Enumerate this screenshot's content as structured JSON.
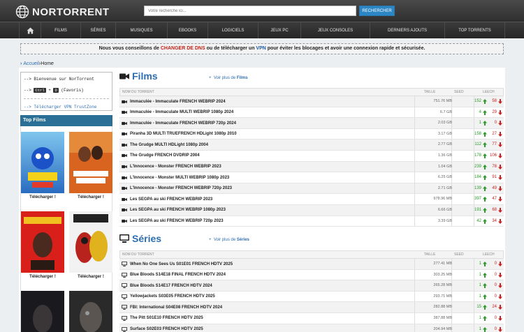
{
  "header": {
    "site_name": "NORTORRENT",
    "search_placeholder": "Votre recherche ici...",
    "search_button": "RECHERCHER"
  },
  "nav": {
    "items": [
      "FILMS",
      "SÉRIES",
      "MUSIQUES",
      "EBOOKS",
      "LOGICIELS",
      "JEUX PC",
      "JEUX CONSOLES",
      "DERNIERS AJOUTS",
      "TOP TORRENTS"
    ]
  },
  "banner": {
    "part1": "Nous vous conseillons de ",
    "link1": "CHANGER DE DNS",
    "part2": " ou de télécharger un ",
    "link2": "VPN",
    "part3": " pour éviter les blocages et avoir une connexion rapide et sécurisée."
  },
  "breadcrumb": {
    "home": "Accueil",
    "sep": " › ",
    "current": "Home"
  },
  "sidebar": {
    "welcome": "--> Bienvenue sur NorTorrent",
    "shortcut_prefix": "-->",
    "key1": "Ctrl",
    "plus": "+",
    "key2": "D",
    "shortcut_suffix": "(Favoris)",
    "vpn_link": "--> Télécharger VPN TrustZone",
    "top_films_title": "Top Films",
    "download_label": "Télécharger !"
  },
  "films": {
    "title": "Films",
    "more_prefix": "Voir plus de ",
    "more_bold": "Films",
    "col_name": "NOM DU TORRENT",
    "col_size": "TAILLE",
    "col_seed": "SEED",
    "col_leech": "LEECH",
    "rows": [
      {
        "name": "Immaculée - Immaculate FRENCH WEBRIP 2024",
        "size": "751.76 MB",
        "seed": "152",
        "leech": "58"
      },
      {
        "name": "Immaculée - Immaculate MULTI WEBRIP 1080p 2024",
        "size": "6.7 GB",
        "seed": "4",
        "leech": "29"
      },
      {
        "name": "Immaculée - Immaculate FRENCH WEBRIP 720p 2024",
        "size": "2.03 GB",
        "seed": "1",
        "leech": "0"
      },
      {
        "name": "Piranha 3D MULTI TRUEFRENCH HDLight 1080p 2010",
        "size": "3.17 GB",
        "seed": "158",
        "leech": "27"
      },
      {
        "name": "The Grudge MULTI HDLight 1080p 2004",
        "size": "2.77 GB",
        "seed": "112",
        "leech": "77"
      },
      {
        "name": "The Grudge FRENCH DVDRIP 2004",
        "size": "1.36 GB",
        "seed": "178",
        "leech": "106"
      },
      {
        "name": "L'Innocence - Monster FRENCH WEBRIP 2023",
        "size": "1.04 GB",
        "seed": "239",
        "leech": "78"
      },
      {
        "name": "L'Innocence - Monster MULTI WEBRIP 1080p 2023",
        "size": "6.25 GB",
        "seed": "184",
        "leech": "91"
      },
      {
        "name": "L'Innocence - Monster FRENCH WEBRIP 720p 2023",
        "size": "2.71 GB",
        "seed": "139",
        "leech": "49"
      },
      {
        "name": "Les SEGPA au ski FRENCH WEBRIP 2023",
        "size": "978.96 MB",
        "seed": "397",
        "leech": "47"
      },
      {
        "name": "Les SEGPA au ski FRENCH WEBRIP 1080p 2023",
        "size": "6.66 GB",
        "seed": "191",
        "leech": "68"
      },
      {
        "name": "Les SEGPA au ski FRENCH WEBRIP 720p 2023",
        "size": "3.39 GB",
        "seed": "42",
        "leech": "34"
      }
    ]
  },
  "series": {
    "title": "Séries",
    "more_prefix": "Voir plus de ",
    "more_bold": "Séries",
    "col_name": "NOM DU TORRENT",
    "col_size": "TAILLE",
    "col_seed": "SEED",
    "col_leech": "LEECH",
    "rows": [
      {
        "name": "When No One Sees Us S01E01 FRENCH HDTV 2025",
        "size": "277.41 MB",
        "seed": "1",
        "leech": "0"
      },
      {
        "name": "Blue Bloods S14E18 FINAL FRENCH HDTV 2024",
        "size": "303.25 MB",
        "seed": "1",
        "leech": "0"
      },
      {
        "name": "Blue Bloods S14E17 FRENCH HDTV 2024",
        "size": "265.28 MB",
        "seed": "1",
        "leech": "0"
      },
      {
        "name": "Yellowjackets S03E05 FRENCH HDTV 2025",
        "size": "293.71 MB",
        "seed": "1",
        "leech": "0"
      },
      {
        "name": "FBI: International S04E08 FRENCH HDTV 2024",
        "size": "282.88 MB",
        "seed": "15",
        "leech": "24"
      },
      {
        "name": "The Pitt S01E10 FRENCH HDTV 2025",
        "size": "387.88 MB",
        "seed": "1",
        "leech": "0"
      },
      {
        "name": "Surface S02E03 FRENCH HDTV 2025",
        "size": "204.94 MB",
        "seed": "1",
        "leech": "0"
      }
    ]
  },
  "colors": {
    "accent": "#2d6eb0",
    "seed": "#2a9a2a",
    "leech": "#c62020",
    "header": "#333333"
  }
}
